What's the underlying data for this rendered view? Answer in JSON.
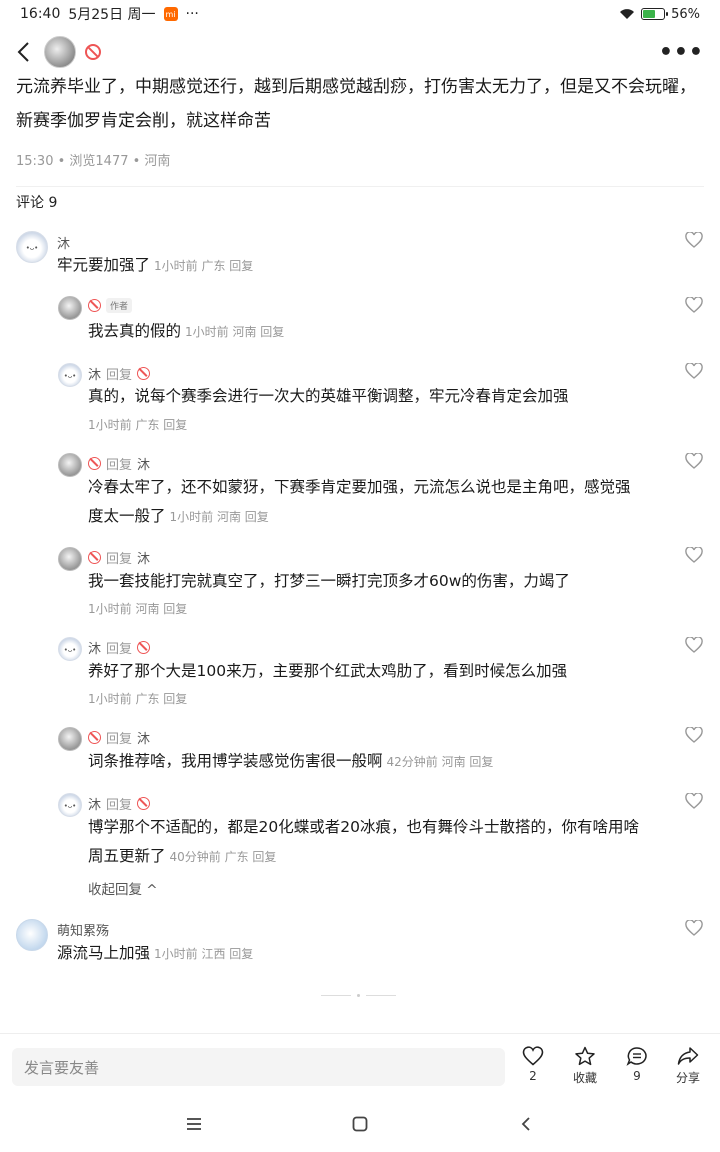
{
  "status_bar": {
    "time": "16:40",
    "date": "5月25日 周一",
    "mi_icon": "mi",
    "more": "···",
    "battery": "56%",
    "battery_level": 0.56,
    "battery_color": "#3bb34a"
  },
  "nav": {
    "more_icon": "•••"
  },
  "post": {
    "body": "元流养毕业了，中期感觉还行，越到后期感觉越刮痧，打伤害太无力了，但是又不会玩曜，新赛季伽罗肯定会削，就这样命苦",
    "meta": "15:30 • 浏览1477 • 河南"
  },
  "comments_header": "评论 9",
  "comments": [
    {
      "name": "沐",
      "text": "牢元要加强了",
      "meta": "1小时前 广东 回复"
    },
    {
      "author_tag": "作者",
      "text": "我去真的假的",
      "meta": "1小时前 河南 回复"
    },
    {
      "name": "沐",
      "reply_word": "回复",
      "text": "真的，说每个赛季会进行一次大的英雄平衡调整，牢元冷春肯定会加强",
      "meta": "1小时前 广东 回复"
    },
    {
      "reply_word": "回复",
      "reply_to": "沐",
      "text_line1": "冷春太牢了，还不如蒙犽，下赛季肯定要加强，元流怎么说也是主角吧，感觉强",
      "text_line2": "度太一般了",
      "meta": "1小时前 河南 回复"
    },
    {
      "reply_word": "回复",
      "reply_to": "沐",
      "text": "我一套技能打完就真空了，打梦三一瞬打完顶多才60w的伤害，力竭了",
      "meta": "1小时前 河南 回复"
    },
    {
      "name": "沐",
      "reply_word": "回复",
      "text": "养好了那个大是100来万，主要那个红武太鸡肋了，看到时候怎么加强",
      "meta": "1小时前 广东 回复"
    },
    {
      "reply_word": "回复",
      "reply_to": "沐",
      "text": "词条推荐啥，我用博学装感觉伤害很一般啊",
      "meta": "42分钟前 河南 回复"
    },
    {
      "name": "沐",
      "reply_word": "回复",
      "text_line1": "博学那个不适配的，都是20化蝶或者20冰痕，也有舞伶斗士散搭的，你有啥用啥",
      "text_line2": "周五更新了",
      "meta": "40分钟前 广东 回复"
    },
    {
      "name": "萌知累殇",
      "text": "源流马上加强",
      "meta": "1小时前 江西 回复"
    }
  ],
  "collapse_label": "收起回复 ^",
  "bottom": {
    "input_placeholder": "发言要友善",
    "like_count": "2",
    "favorite_label": "收藏",
    "comment_count": "9",
    "share_label": "分享"
  }
}
